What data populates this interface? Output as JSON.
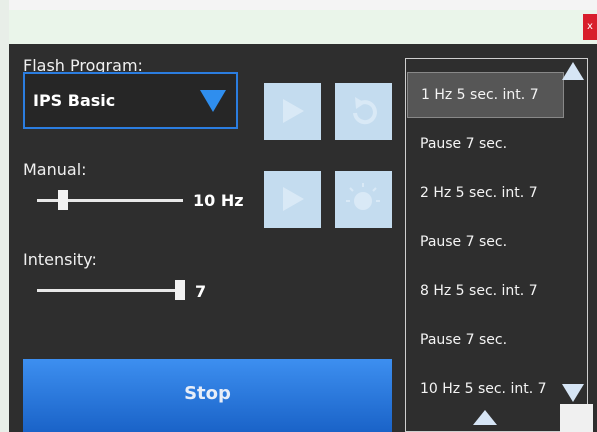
{
  "window": {
    "close_label": "x"
  },
  "flash_program": {
    "label": "Flash Program:",
    "selected": "IPS Basic",
    "play_icon": "play-icon",
    "repeat_icon": "repeat-icon"
  },
  "manual": {
    "label": "Manual:",
    "value": "10 Hz",
    "play_icon": "play-icon",
    "light_icon": "light-icon"
  },
  "intensity": {
    "label": "Intensity:",
    "value": "7"
  },
  "stop_label": "Stop",
  "program_list": {
    "items": [
      {
        "label": "1 Hz 5 sec. int. 7",
        "selected": true
      },
      {
        "label": "Pause 7 sec."
      },
      {
        "label": "2 Hz 5 sec. int. 7"
      },
      {
        "label": "Pause 7 sec."
      },
      {
        "label": "8 Hz 5 sec. int. 7"
      },
      {
        "label": "Pause 7 sec."
      },
      {
        "label": "10 Hz 5 sec. int. 7"
      }
    ]
  },
  "colors": {
    "accent": "#2b7de0",
    "button_disabled": "#c4dcef",
    "close": "#d81f2b",
    "background": "#2e2e2e"
  }
}
